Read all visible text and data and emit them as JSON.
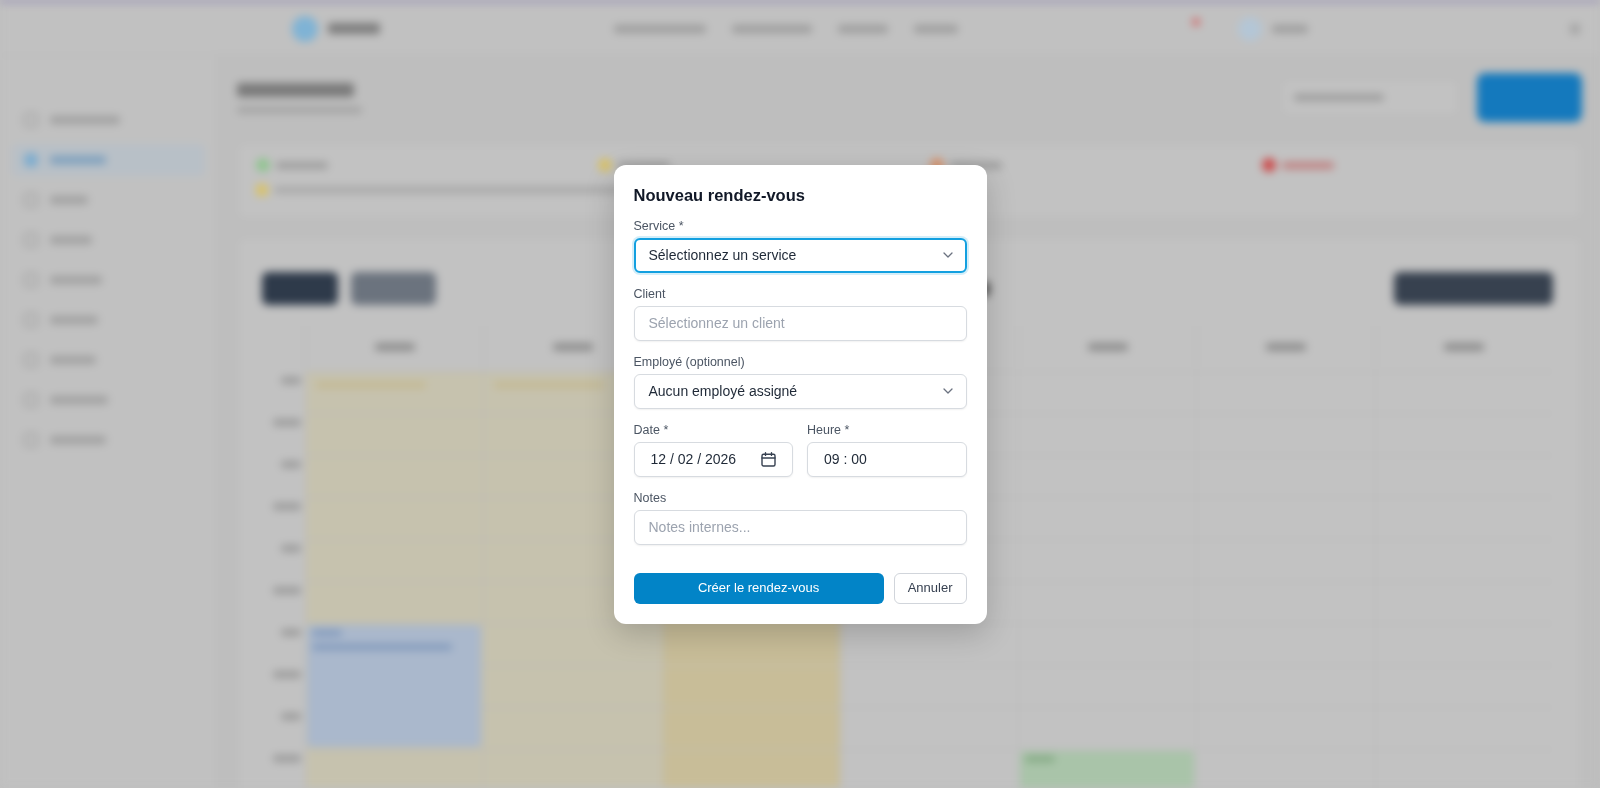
{
  "dialog": {
    "title": "Nouveau rendez-vous",
    "rows": [
      [
        {
          "kind": "select",
          "label": "Service *",
          "value": "Sélectionnez un service",
          "focused": true
        }
      ],
      [
        {
          "kind": "input",
          "label": "Client",
          "placeholder": "Sélectionnez un client",
          "focused": false
        }
      ],
      [
        {
          "kind": "select",
          "label": "Employé (optionnel)",
          "value": "Aucun employé assigné",
          "focused": false
        }
      ],
      [
        {
          "kind": "date",
          "label": "Date *",
          "value": "12 / 02 / 2026",
          "focused": false
        },
        {
          "kind": "time",
          "label": "Heure *",
          "value": "09 : 00",
          "focused": false
        }
      ],
      [
        {
          "kind": "input",
          "label": "Notes",
          "placeholder": "Notes internes...",
          "focused": false
        }
      ]
    ],
    "buttons": [
      {
        "kind": "primary",
        "label": "Créer le rendez-vous"
      },
      {
        "kind": "secondary",
        "label": "Annuler"
      }
    ]
  }
}
